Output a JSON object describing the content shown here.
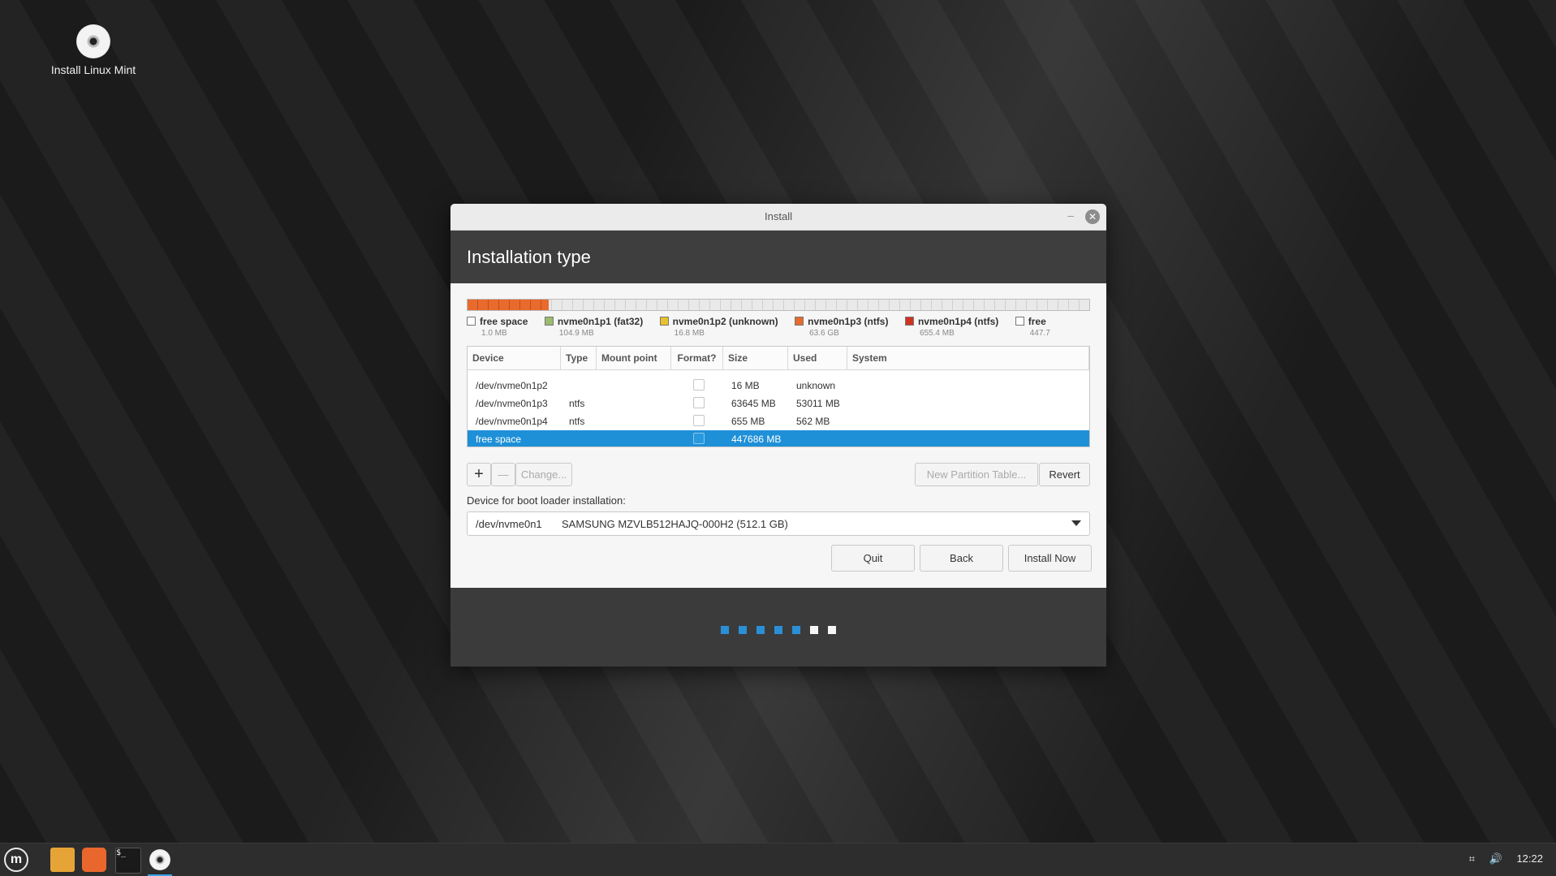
{
  "desktop": {
    "icon_label": "Install Linux Mint"
  },
  "window": {
    "title": "Install",
    "heading": "Installation type"
  },
  "disk_bar": {
    "used_fraction": 0.13
  },
  "legend": [
    {
      "name": "free space",
      "size": "1.0 MB",
      "color": "#ffffff"
    },
    {
      "name": "nvme0n1p1 (fat32)",
      "size": "104.9 MB",
      "color": "#9bbb6e"
    },
    {
      "name": "nvme0n1p2 (unknown)",
      "size": "16.8 MB",
      "color": "#e8c22a"
    },
    {
      "name": "nvme0n1p3 (ntfs)",
      "size": "63.6 GB",
      "color": "#e86a2d"
    },
    {
      "name": "nvme0n1p4 (ntfs)",
      "size": "655.4 MB",
      "color": "#d0331e"
    },
    {
      "name": "free",
      "size": "447.7",
      "color": "#ffffff"
    }
  ],
  "table": {
    "headers": [
      "Device",
      "Type",
      "Mount point",
      "Format?",
      "Size",
      "Used",
      "System"
    ],
    "rows": [
      {
        "device": "/dev/nvme0n1p2",
        "type": "",
        "mount": "",
        "size": "16 MB",
        "used": "unknown",
        "system": ""
      },
      {
        "device": "/dev/nvme0n1p3",
        "type": "ntfs",
        "mount": "",
        "size": "63645 MB",
        "used": "53011 MB",
        "system": ""
      },
      {
        "device": "/dev/nvme0n1p4",
        "type": "ntfs",
        "mount": "",
        "size": "655 MB",
        "used": "562 MB",
        "system": ""
      },
      {
        "device": "free space",
        "type": "",
        "mount": "",
        "size": "447686 MB",
        "used": "",
        "system": ""
      }
    ]
  },
  "buttons": {
    "add": "+",
    "remove": "—",
    "change": "Change...",
    "new_table": "New Partition Table...",
    "revert": "Revert",
    "quit": "Quit",
    "back": "Back",
    "install": "Install Now"
  },
  "bootloader": {
    "label": "Device for boot loader installation:",
    "device": "/dev/nvme0n1",
    "model": "SAMSUNG MZVLB512HAJQ-000H2 (512.1 GB)"
  },
  "progress": {
    "completed_steps": 5,
    "total_steps": 7
  },
  "taskbar": {
    "clock": "12:22",
    "menu_glyph": "m",
    "terminal_glyph": "$_"
  }
}
